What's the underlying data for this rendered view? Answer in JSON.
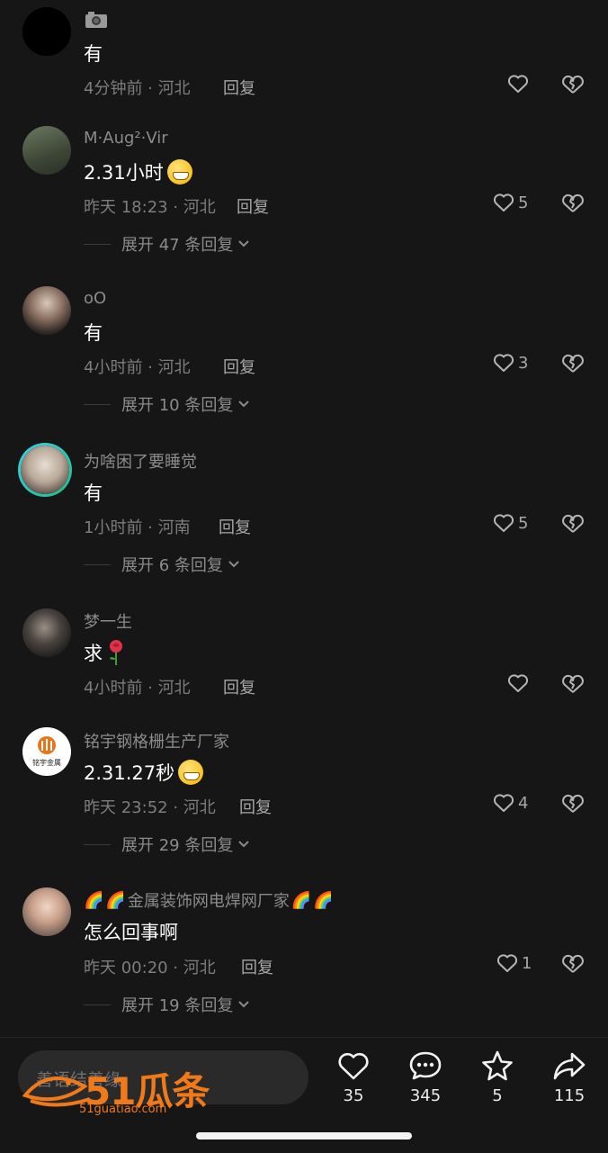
{
  "comments": [
    {
      "username": "",
      "text": "有",
      "meta": "4分钟前 · 河北",
      "reply": "回复",
      "likes": "",
      "expand": ""
    },
    {
      "username": "M·Aug²·Vir",
      "text": "2.31小时",
      "meta": "昨天 18:23 · 河北",
      "reply": "回复",
      "likes": "5",
      "expand": "展开 47 条回复"
    },
    {
      "username": "oO",
      "text": "有",
      "meta": "4小时前 · 河北",
      "reply": "回复",
      "likes": "3",
      "expand": "展开 10 条回复"
    },
    {
      "username": "为啥困了要睡觉",
      "text": "有",
      "meta": "1小时前 · 河南",
      "reply": "回复",
      "likes": "5",
      "expand": "展开 6 条回复"
    },
    {
      "username": "梦一生",
      "text": "求",
      "meta": "4小时前 · 河北",
      "reply": "回复",
      "likes": "",
      "expand": ""
    },
    {
      "username": "铭宇钢格栅生产厂家",
      "text": "2.31.27秒",
      "meta": "昨天 23:52 · 河北",
      "reply": "回复",
      "likes": "4",
      "expand": "展开 29 条回复",
      "avatar_label": "铭宇金属"
    },
    {
      "username": "金属装饰网电焊网厂家",
      "text": "怎么回事啊",
      "meta": "昨天 00:20 · 河北",
      "reply": "回复",
      "likes": "1",
      "expand": "展开 19 条回复"
    }
  ],
  "bottom_bar": {
    "input_placeholder": "善语结善缘",
    "like_count": "35",
    "comment_count": "345",
    "favorite_count": "5",
    "share_count": "115"
  },
  "watermark": {
    "name": "51瓜条",
    "url": "51guatiao.com"
  },
  "colors": {
    "background": "#161616",
    "secondary_text": "#8b8b8b",
    "watermark": "#f07a1a"
  }
}
